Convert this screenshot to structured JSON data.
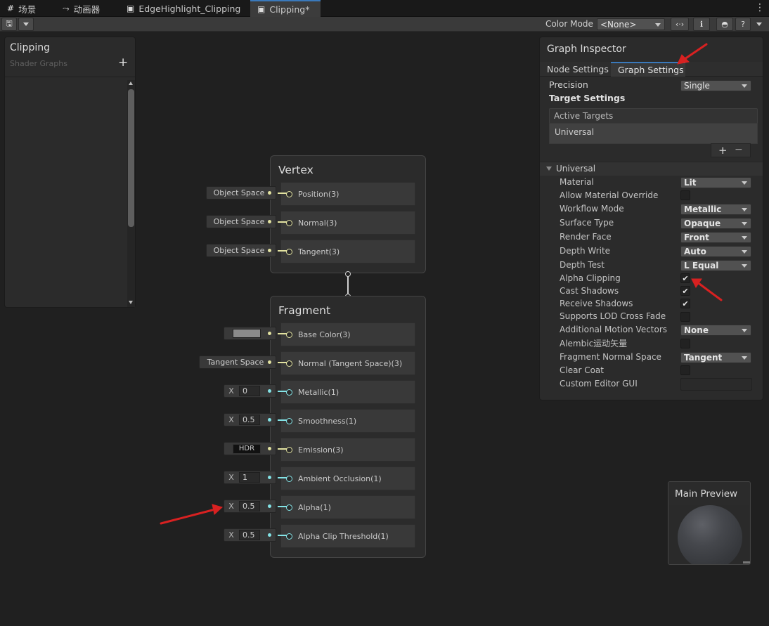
{
  "tabs": [
    {
      "icon": "grid-icon",
      "label": "场景"
    },
    {
      "icon": "animator-icon",
      "label": "动画器"
    },
    {
      "icon": "shadergraph-icon",
      "label": "EdgeHighlight_Clipping"
    },
    {
      "icon": "shadergraph-icon",
      "label": "Clipping*"
    }
  ],
  "toolbar": {
    "color_mode_label": "Color Mode",
    "color_mode_value": "<None>"
  },
  "blackboard": {
    "title": "Clipping",
    "subtitle": "Shader Graphs",
    "add_label": "+"
  },
  "vertex_node": {
    "title": "Vertex",
    "slots": [
      {
        "label": "Position(3)",
        "input": "Object Space"
      },
      {
        "label": "Normal(3)",
        "input": "Object Space"
      },
      {
        "label": "Tangent(3)",
        "input": "Object Space"
      }
    ]
  },
  "fragment_node": {
    "title": "Fragment",
    "slots": [
      {
        "label": "Base Color(3)",
        "input_type": "color",
        "color": "#8a8a8a"
      },
      {
        "label": "Normal (Tangent Space)(3)",
        "input": "Tangent Space"
      },
      {
        "label": "Metallic(1)",
        "x": "X",
        "value": "0"
      },
      {
        "label": "Smoothness(1)",
        "x": "X",
        "value": "0.5"
      },
      {
        "label": "Emission(3)",
        "input": "HDR"
      },
      {
        "label": "Ambient Occlusion(1)",
        "x": "X",
        "value": "1"
      },
      {
        "label": "Alpha(1)",
        "x": "X",
        "value": "0.5"
      },
      {
        "label": "Alpha Clip Threshold(1)",
        "x": "X",
        "value": "0.5"
      }
    ]
  },
  "inspector": {
    "title": "Graph Inspector",
    "tabs": [
      "Node Settings",
      "Graph Settings"
    ],
    "active_tab": "Graph Settings",
    "precision_label": "Precision",
    "precision_value": "Single",
    "target_settings_label": "Target Settings",
    "active_targets_label": "Active Targets",
    "active_target": "Universal",
    "add_symbol": "+",
    "remove_symbol": "−",
    "section_label": "Universal",
    "properties": [
      {
        "label": "Material",
        "type": "dropdown",
        "value": "Lit"
      },
      {
        "label": "Allow Material Override",
        "type": "checkbox",
        "checked": false
      },
      {
        "label": "Workflow Mode",
        "type": "dropdown",
        "value": "Metallic"
      },
      {
        "label": "Surface Type",
        "type": "dropdown",
        "value": "Opaque"
      },
      {
        "label": "Render Face",
        "type": "dropdown",
        "value": "Front"
      },
      {
        "label": "Depth Write",
        "type": "dropdown",
        "value": "Auto"
      },
      {
        "label": "Depth Test",
        "type": "dropdown",
        "value": "L Equal"
      },
      {
        "label": "Alpha Clipping",
        "type": "checkbox",
        "checked": true
      },
      {
        "label": "Cast Shadows",
        "type": "checkbox",
        "checked": true
      },
      {
        "label": "Receive Shadows",
        "type": "checkbox",
        "checked": true
      },
      {
        "label": "Supports LOD Cross Fade",
        "type": "checkbox",
        "checked": false
      },
      {
        "label": "Additional Motion Vectors",
        "type": "dropdown",
        "value": "None"
      },
      {
        "label": "Alembic运动矢量",
        "type": "checkbox",
        "checked": false
      },
      {
        "label": "Fragment Normal Space",
        "type": "dropdown",
        "value": "Tangent"
      },
      {
        "label": "Clear Coat",
        "type": "checkbox",
        "checked": false
      },
      {
        "label": "Custom Editor GUI",
        "type": "text",
        "value": ""
      }
    ]
  },
  "main_preview": {
    "title": "Main Preview"
  },
  "colors": {
    "vertex_port": "#e2e2a0",
    "float_port": "#84e4e7",
    "accent_tab": "#3a79bb",
    "annotation_arrow": "#d82121"
  }
}
